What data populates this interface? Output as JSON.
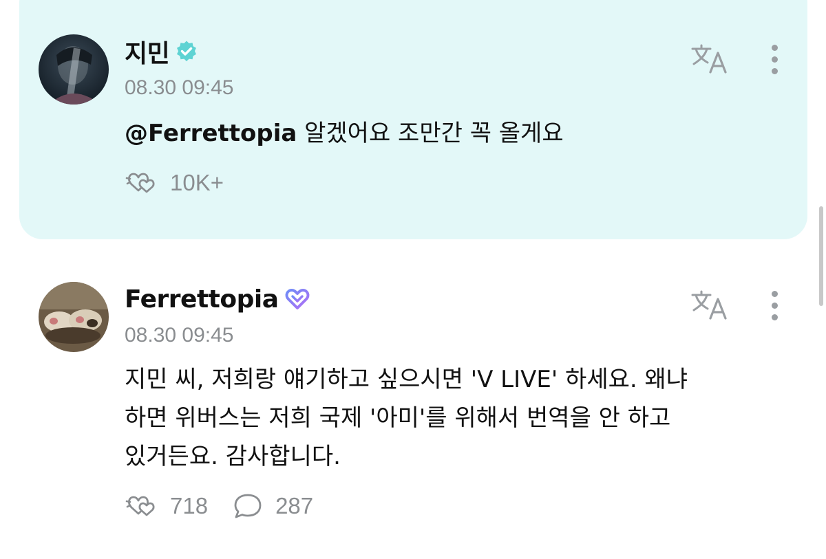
{
  "posts": [
    {
      "author": "지민",
      "badge": "verified-check",
      "timestamp": "08.30 09:45",
      "mention": "@Ferrettopia",
      "text": " 알겠어요 조만간 꼭 올게요",
      "likes": "10K+",
      "highlighted": true
    },
    {
      "author": "Ferrettopia",
      "badge": "weverse-heart",
      "timestamp": "08.30 09:45",
      "lines": [
        "지민 씨, 저희랑 얘기하고 싶으시면 'V LIVE' 하세요. 왜냐",
        "하면 위버스는 저희 국제 '아미'를 위해서 번역을 안 하고",
        "있거든요. 감사합니다."
      ],
      "likes": "718",
      "comments": "287",
      "highlighted": false
    }
  ],
  "icons": {
    "translate": "translate-icon",
    "more": "more-vertical-icon",
    "like": "like-heart-icon",
    "comment": "comment-bubble-icon"
  },
  "colors": {
    "highlight_bg": "#e3f8f8",
    "verified": "#5ed3d3",
    "weverse_badge": "#8b7cf6",
    "muted_text": "#8a8d90"
  }
}
